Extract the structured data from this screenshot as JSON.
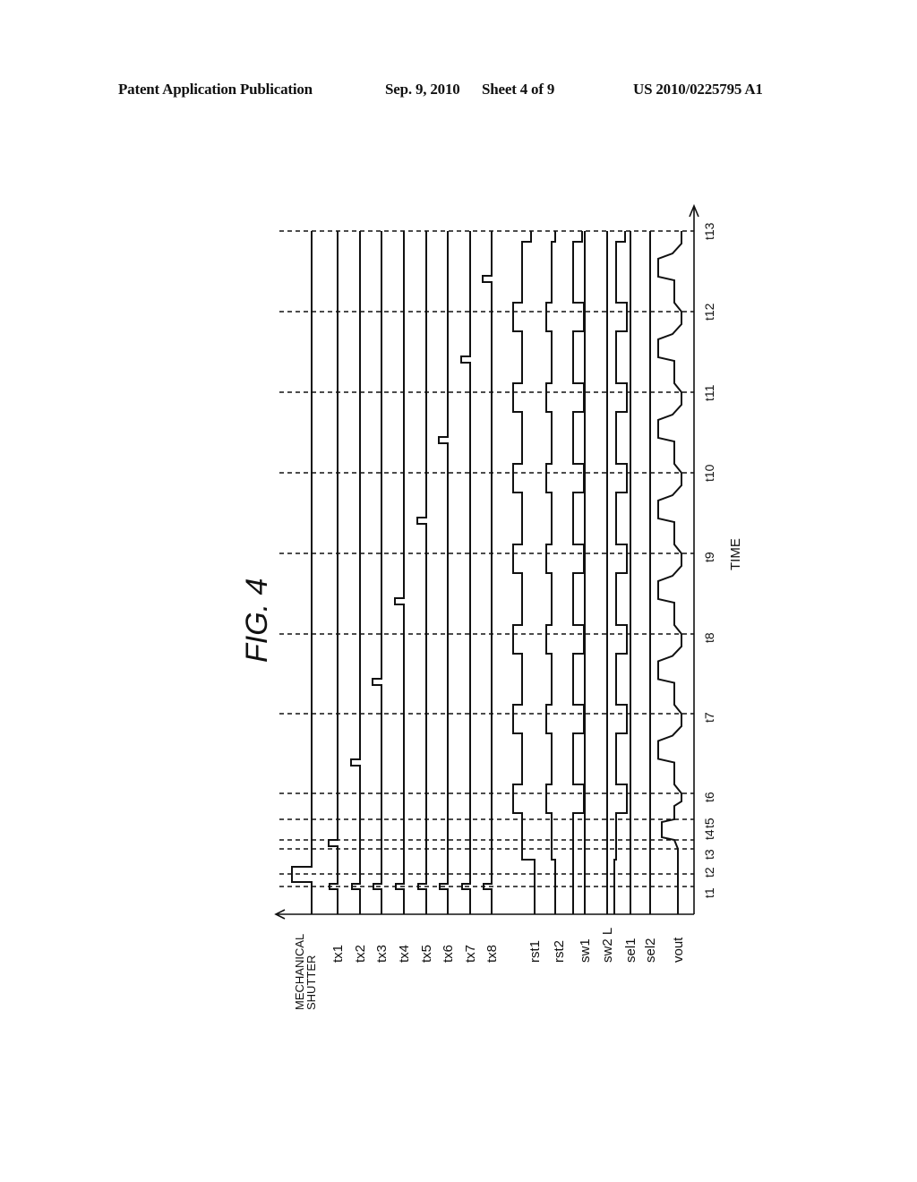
{
  "header": {
    "publication": "Patent Application Publication",
    "date": "Sep. 9, 2010",
    "sheet": "Sheet 4 of 9",
    "number": "US 2010/0225795 A1"
  },
  "figure": {
    "title": "FIG.  4",
    "time_axis_label": "TIME",
    "time_markers": [
      "t1",
      "t2",
      "t3",
      "t4",
      "t5",
      "t6",
      "t7",
      "t8",
      "t9",
      "t10",
      "t11",
      "t12",
      "t13"
    ],
    "signals": [
      {
        "name": "MECHANICAL SHUTTER",
        "lines": [
          "MECHANICAL",
          "SHUTTER"
        ]
      },
      {
        "name": "tx1"
      },
      {
        "name": "tx2"
      },
      {
        "name": "tx3"
      },
      {
        "name": "tx4"
      },
      {
        "name": "tx5"
      },
      {
        "name": "tx6"
      },
      {
        "name": "tx7"
      },
      {
        "name": "tx8"
      },
      {
        "name": "rst1"
      },
      {
        "name": "rst2"
      },
      {
        "name": "sw1"
      },
      {
        "name": "sw2 L"
      },
      {
        "name": "sel1"
      },
      {
        "name": "sel2"
      },
      {
        "name": "vout"
      }
    ]
  },
  "chart_data": {
    "type": "timing-diagram",
    "title": "FIG. 4",
    "xlabel": "TIME",
    "time_ticks": [
      "t1",
      "t2",
      "t3",
      "t4",
      "t5",
      "t6",
      "t7",
      "t8",
      "t9",
      "t10",
      "t11",
      "t12",
      "t13"
    ],
    "orientation": "rotated 90° counter-clockwise (time increases upward)",
    "series": [
      {
        "name": "MECHANICAL SHUTTER",
        "description": "pulse high between t1 and t2 region (opens at t1+, closes at t2)",
        "events": [
          {
            "type": "high",
            "from": "t1",
            "to": "t2"
          }
        ]
      },
      {
        "name": "tx1",
        "events": [
          {
            "type": "pulse",
            "at": "t1"
          },
          {
            "type": "pulse",
            "at": "t3-t4"
          }
        ]
      },
      {
        "name": "tx2",
        "events": [
          {
            "type": "pulse",
            "at": "t1"
          },
          {
            "type": "pulse",
            "at": "between t6 and t7"
          }
        ]
      },
      {
        "name": "tx3",
        "events": [
          {
            "type": "pulse",
            "at": "t1"
          },
          {
            "type": "pulse",
            "at": "between t7 and t8"
          }
        ]
      },
      {
        "name": "tx4",
        "events": [
          {
            "type": "pulse",
            "at": "t1"
          },
          {
            "type": "pulse",
            "at": "between t8 and t9"
          }
        ]
      },
      {
        "name": "tx5",
        "events": [
          {
            "type": "pulse",
            "at": "t1"
          },
          {
            "type": "pulse",
            "at": "between t9 and t10"
          }
        ]
      },
      {
        "name": "tx6",
        "events": [
          {
            "type": "pulse",
            "at": "t1"
          },
          {
            "type": "pulse",
            "at": "between t10 and t11"
          }
        ]
      },
      {
        "name": "tx7",
        "events": [
          {
            "type": "pulse",
            "at": "t1"
          },
          {
            "type": "pulse",
            "at": "between t11 and t12"
          }
        ]
      },
      {
        "name": "tx8",
        "events": [
          {
            "type": "pulse",
            "at": "t1"
          },
          {
            "type": "pulse",
            "at": "between t12 and t13"
          }
        ]
      },
      {
        "name": "rst1",
        "events": [
          {
            "type": "low-high",
            "from": "t2",
            "to": "t6"
          },
          {
            "type": "pulse-low",
            "at": [
              "t6",
              "t7",
              "t8",
              "t9",
              "t10",
              "t11",
              "t12"
            ]
          }
        ]
      },
      {
        "name": "rst2",
        "events": [
          {
            "type": "low-high",
            "from": "t2",
            "to": "t6"
          },
          {
            "type": "pulse",
            "at": [
              "t6",
              "t7",
              "t8",
              "t9",
              "t10",
              "t11",
              "t12"
            ]
          }
        ]
      },
      {
        "name": "sw1",
        "events": [
          {
            "type": "low-high",
            "from": "t2",
            "to": "t6"
          },
          {
            "type": "pulse-low",
            "at": [
              "t6",
              "t7",
              "t8",
              "t9",
              "t10",
              "t11",
              "t12"
            ]
          }
        ]
      },
      {
        "name": "sw2 L",
        "events": [
          {
            "type": "constant-low"
          }
        ]
      },
      {
        "name": "sel1",
        "events": [
          {
            "type": "low-high",
            "from": "t2",
            "to": "t6"
          },
          {
            "type": "pulse-low",
            "at": [
              "t6",
              "t7",
              "t8",
              "t9",
              "t10",
              "t11",
              "t12"
            ]
          }
        ]
      },
      {
        "name": "sel2",
        "events": [
          {
            "type": "constant-low"
          }
        ]
      },
      {
        "name": "vout",
        "events": [
          {
            "type": "step-levels",
            "at": [
              "t4",
              "t6",
              "t7",
              "t8",
              "t9",
              "t10",
              "t11",
              "t12",
              "t13"
            ]
          }
        ]
      }
    ]
  }
}
